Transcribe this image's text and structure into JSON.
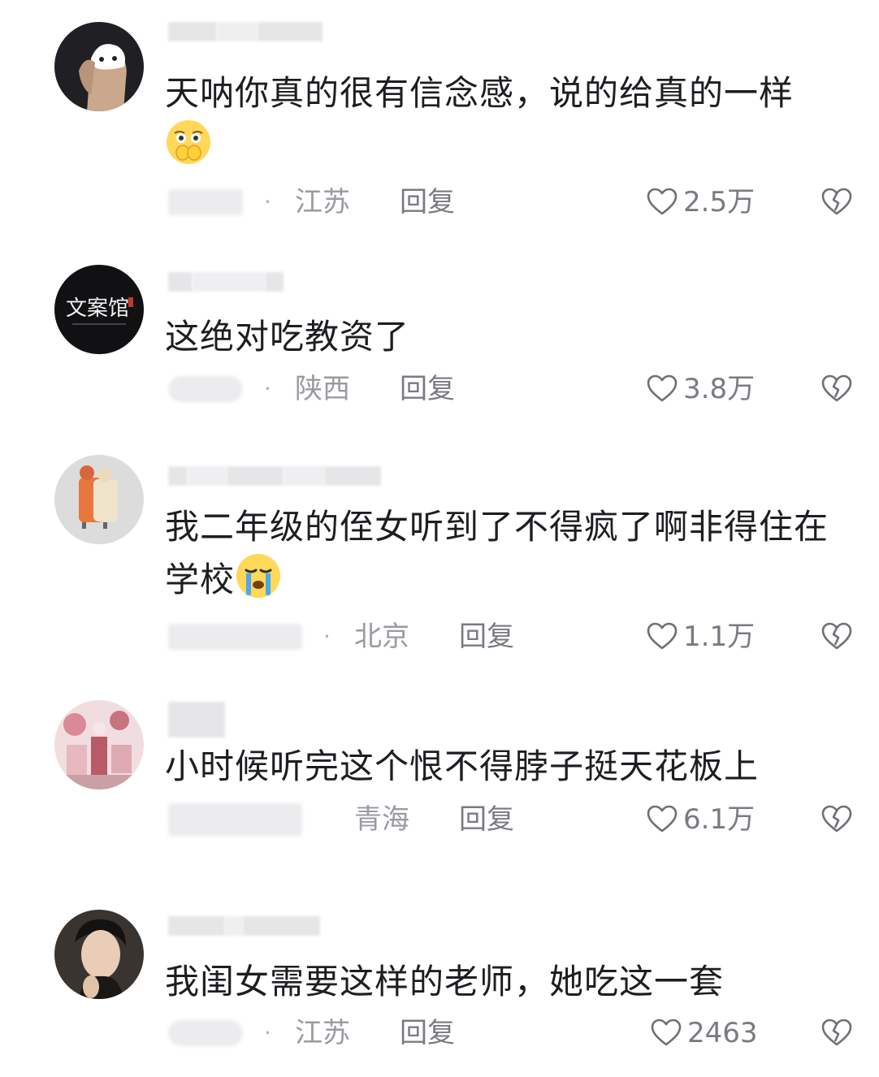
{
  "comments": [
    {
      "text": "天呐你真的很有信念感，说的给真的一样",
      "emoji": "blush-hands-emoji",
      "location": "江苏",
      "reply": "回复",
      "likes": "2.5万"
    },
    {
      "text": "这绝对吃教资了",
      "avatar_text": "文案馆",
      "location": "陕西",
      "reply": "回复",
      "likes": "3.8万"
    },
    {
      "text": "我二年级的侄女听到了不得疯了啊非得住在学校",
      "emoji": "crying-face-emoji",
      "location": "北京",
      "reply": "回复",
      "likes": "1.1万"
    },
    {
      "text": "小时候听完这个恨不得脖子挺天花板上",
      "location": "青海",
      "reply": "回复",
      "likes": "6.1万"
    },
    {
      "text": "我闺女需要这样的老师，她吃这一套",
      "location": "江苏",
      "reply": "回复",
      "likes": "2463"
    }
  ],
  "meta": {
    "separator": "·"
  }
}
